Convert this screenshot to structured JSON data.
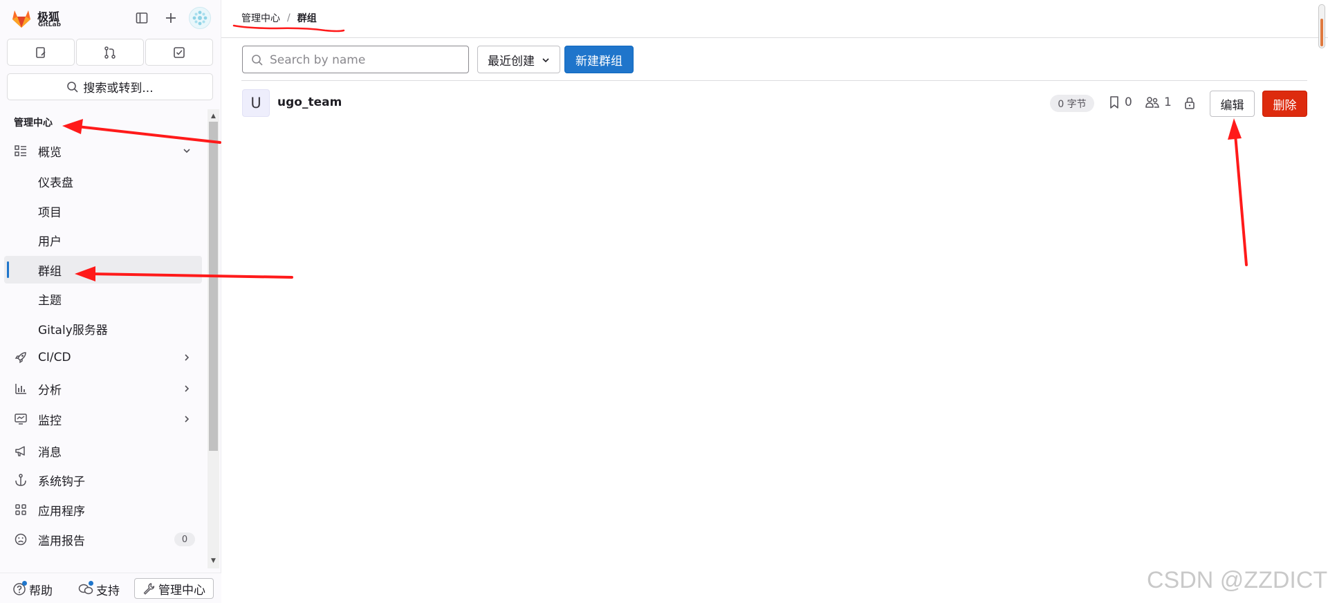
{
  "brand": {
    "name_cn": "极狐",
    "name_en": "GitLab"
  },
  "sidebar": {
    "search_label": "搜索或转到...",
    "section_title": "管理中心",
    "items": [
      {
        "label": "概览"
      },
      {
        "label": "仪表盘"
      },
      {
        "label": "项目"
      },
      {
        "label": "用户"
      },
      {
        "label": "群组"
      },
      {
        "label": "主题"
      },
      {
        "label": "Gitaly服务器"
      },
      {
        "label": "CI/CD"
      },
      {
        "label": "分析"
      },
      {
        "label": "监控"
      },
      {
        "label": "消息"
      },
      {
        "label": "系统钩子"
      },
      {
        "label": "应用程序"
      },
      {
        "label": "滥用报告",
        "count": "0"
      }
    ],
    "bottom": {
      "help": "帮助",
      "support": "支持",
      "admin": "管理中心"
    }
  },
  "breadcrumb": {
    "root": "管理中心",
    "separator": "/",
    "current": "群组"
  },
  "toolbar": {
    "search_placeholder": "Search by name",
    "sort_label": "最近创建",
    "new_group_label": "新建群组"
  },
  "groups": [
    {
      "avatar_letter": "U",
      "name": "ugo_team",
      "size": "0 字节",
      "projects_count": "0",
      "members_count": "1",
      "edit_label": "编辑",
      "delete_label": "删除"
    }
  ],
  "watermark": "CSDN @ZZDICT",
  "colors": {
    "primary": "#1f75cb",
    "danger": "#dd2b0e",
    "annotation": "#ff1a1a",
    "sidebar_bg": "#fbfafd"
  }
}
